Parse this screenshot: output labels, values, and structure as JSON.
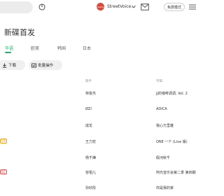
{
  "header": {
    "username": "StreetVoice...",
    "avatar_text": "StreetVoice",
    "free_mode_label": "免费模式"
  },
  "page": {
    "title": "新碟首发",
    "tabs": [
      "华语",
      "欧美",
      "韩国",
      "日本"
    ],
    "active_tab": 0
  },
  "actions": {
    "download_label": "下载",
    "batch_label": "批量操作"
  },
  "table": {
    "columns": [
      "歌手",
      "专辑"
    ],
    "rows": [
      {
        "artist": "林俊杰",
        "album": "JJ的咖啡调调, Vol. 2",
        "badge": ""
      },
      {
        "artist": "ØZI",
        "album": "ADICA",
        "badge": ""
      },
      {
        "artist": "成龙",
        "album": "我心万里雄",
        "badge": ""
      },
      {
        "artist": "王力宏",
        "album": "ONE 一个 (Live 版)",
        "badge": "VIP"
      },
      {
        "artist": "杨千嬅",
        "album": "假河秋千",
        "badge": ""
      },
      {
        "artist": "容祖儿",
        "album": "阿光音乐会第二季 第四期",
        "badge": "SQ"
      },
      {
        "artist": "孙欣彤",
        "album": "你是我的家",
        "badge": ""
      }
    ]
  },
  "colors": {
    "accent": "#23b26e",
    "avatar_bg": "#d94a3a"
  }
}
